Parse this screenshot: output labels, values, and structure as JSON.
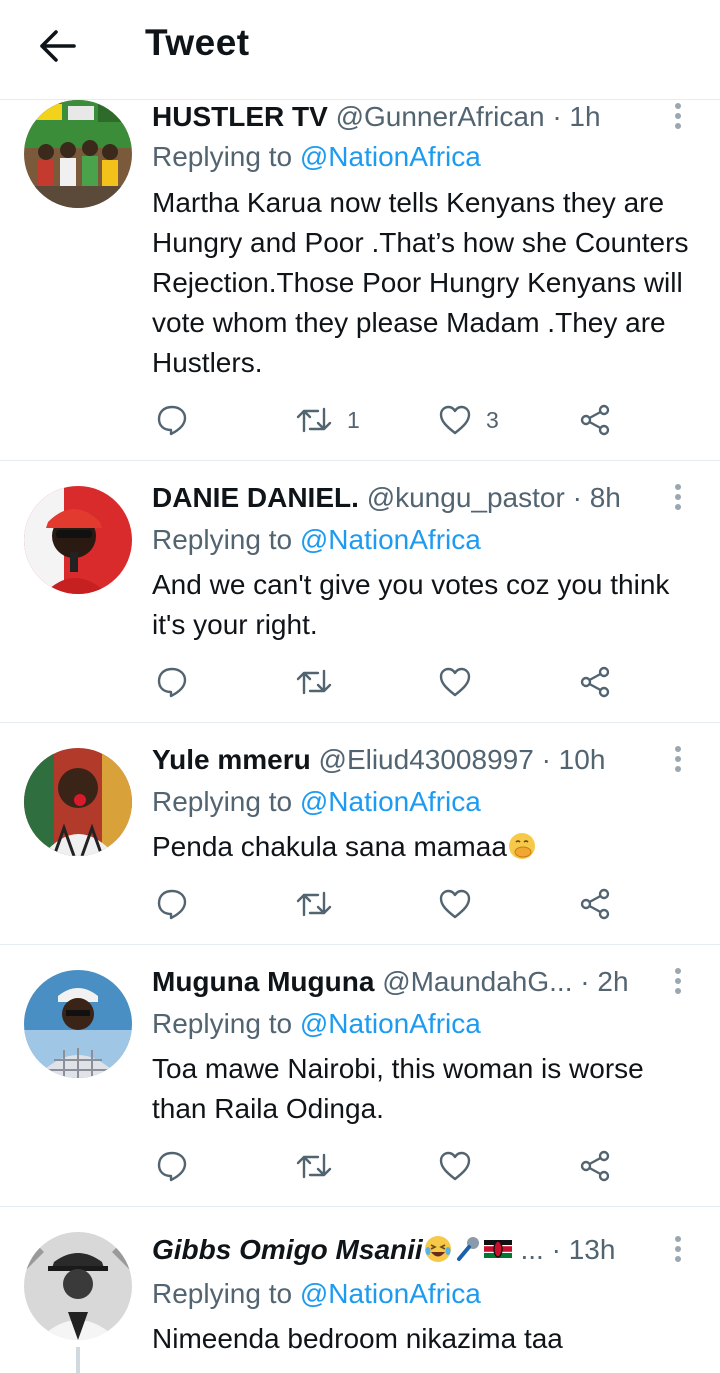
{
  "header": {
    "title": "Tweet"
  },
  "tweets": [
    {
      "name": "HUSTLER TV",
      "handle": "@GunnerAfrican",
      "dot": "·",
      "time": "1h",
      "replying_prefix": "Replying to ",
      "replying_to": "@NationAfrica",
      "text": "Martha Karua now tells Kenyans they are Hungry and Poor .That’s how she Counters Rejection.Those Poor Hungry Kenyans will vote whom they please Madam .They are Hustlers.",
      "retweets": "1",
      "likes": "3"
    },
    {
      "name": "DANIE DANIEL.",
      "handle": "@kungu_pastor",
      "dot": "·",
      "time": "8h",
      "replying_prefix": "Replying to ",
      "replying_to": "@NationAfrica",
      "text": "And we can't give you votes coz you think it's your right.",
      "retweets": "",
      "likes": ""
    },
    {
      "name": "Yule mmeru",
      "handle": "@Eliud43008997",
      "dot": "·",
      "time": "10h",
      "replying_prefix": "Replying to ",
      "replying_to": "@NationAfrica",
      "text": "Penda chakula sana mamaa",
      "text_emoji": "face-with-hand-over-mouth",
      "retweets": "",
      "likes": ""
    },
    {
      "name": "Muguna Muguna",
      "handle": "@MaundahG...",
      "dot": "·",
      "time": "2h",
      "replying_prefix": "Replying to ",
      "replying_to": "@NationAfrica",
      "text": "Toa mawe Nairobi, this woman is worse than Raila Odinga.",
      "retweets": "",
      "likes": ""
    },
    {
      "name": "Gibbs Omigo Msanii",
      "name_emojis": [
        "laughing-tears",
        "microphone",
        "kenya-flag"
      ],
      "name_ellipsis": "...",
      "dot": "·",
      "time": "13h",
      "replying_prefix": "Replying to ",
      "replying_to": "@NationAfrica",
      "text": "Nimeenda bedroom nikazima taa"
    }
  ],
  "icons": {
    "back": "arrow-left-icon",
    "more": "more-vertical-icon",
    "reply": "comment-icon",
    "retweet": "retweet-icon",
    "like": "heart-icon",
    "share": "share-icon"
  },
  "colors": {
    "link": "#1d9bf0",
    "muted": "#536471",
    "text": "#0f1419",
    "divider": "#e6ecf0"
  }
}
